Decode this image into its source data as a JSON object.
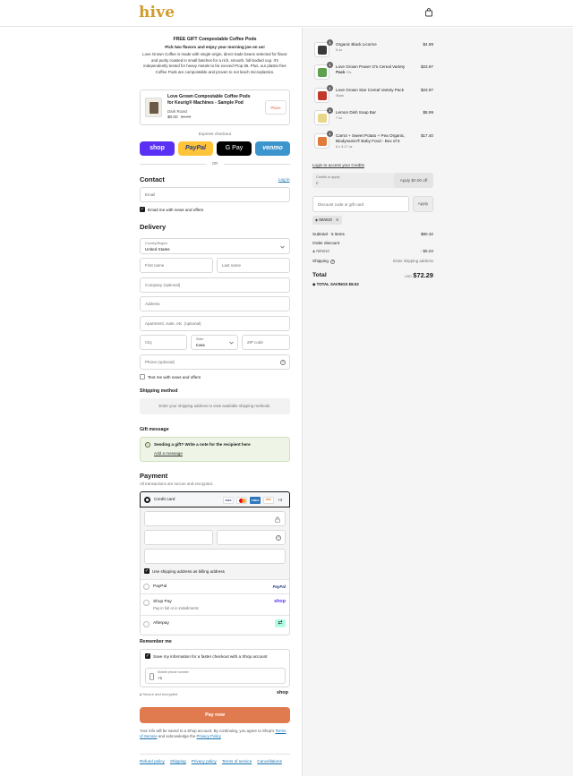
{
  "brand": {
    "logo": "hive"
  },
  "promo": {
    "title": "FREE GIFT Compostable Coffee Pods",
    "subtitle": "Pick two flavors and enjoy your morning joe on us!",
    "body": "Love Grown Coffee is made with single-origin, direct trade beans selected for flavor and purity roasted in small batches for a rich, smooth, full-bodied cup. It's independently tested for heavy metals to far exceed Prop 65. Plus, our plastic-free Coffee Pods are compostable and proven to not leach microplastics.",
    "product_name": "Love Grown Compostable Coffee Pods for Keurig® Machines - Sample Pod",
    "product_variant": "Dark Roast",
    "price": "$0.00",
    "old_price": "$1.50",
    "action": "Place"
  },
  "express": {
    "label": "Express checkout",
    "or": "OR",
    "shop": "shop",
    "paypal": "PayPal",
    "gpay": "G Pay",
    "venmo": "venmo"
  },
  "contact": {
    "heading": "Contact",
    "login": "Log in",
    "email_placeholder": "Email",
    "news_label": "Email me with news and offers"
  },
  "delivery": {
    "heading": "Delivery",
    "country_label": "Country/Region",
    "country_value": "United States",
    "first_name": "First name",
    "last_name": "Last name",
    "company": "Company (optional)",
    "address": "Address",
    "apartment": "Apartment, suite, etc. (optional)",
    "city": "City",
    "state_label": "State",
    "state_value": "Iowa",
    "zip": "ZIP code",
    "phone": "Phone (optional)",
    "text_label": "Text me with news and offers"
  },
  "shipping": {
    "heading": "Shipping method",
    "placeholder": "Enter your shipping address to view available shipping methods."
  },
  "gift": {
    "heading": "Gift message",
    "title": "Sending a gift? Write a note for the recipient here",
    "link": "Add a message"
  },
  "payment": {
    "heading": "Payment",
    "note": "All transactions are secure and encrypted.",
    "credit_card": "Credit card",
    "cards": [
      "VISA",
      "MC",
      "AMEX",
      "DISC"
    ],
    "more": "+4",
    "billing_label": "Use shipping address as billing address",
    "paypal": "PayPal",
    "paypal_logo": "PayPal",
    "shop_pay": "Shop Pay",
    "shop_pay_sub": "Pay in full or in installments",
    "shop_logo": "shop",
    "afterpay": "Afterpay"
  },
  "remember": {
    "heading": "Remember me",
    "save_label": "Save my information for a faster checkout with a Shop account",
    "mobile_label": "Mobile phone number",
    "mobile_value": "+1",
    "secure": "Secure and encrypted",
    "shop_logo": "shop"
  },
  "pay_button": "Pay now",
  "legal": {
    "text": "Your info will be saved to a Shop account. By continuing, you agree to Shop's",
    "terms": "Terms of Service",
    "and": "and acknowledge the",
    "privacy": "Privacy Policy"
  },
  "footer": {
    "links": [
      "Refund policy",
      "Shipping",
      "Privacy policy",
      "Terms of service",
      "Cancellations"
    ]
  },
  "cart": {
    "items": [
      {
        "qty": "1",
        "name": "Organic Black Licorice",
        "variant": "5 oz",
        "price": "$4.89",
        "color": "#3a3a3a"
      },
      {
        "qty": "1",
        "name": "Love Grown Power O's Cereal Variety Pack",
        "variant": "Power O's",
        "price": "$23.97",
        "color": "#5fa04e"
      },
      {
        "qty": "1",
        "name": "Love Grown Star Cereal Variety Pack",
        "variant": "Stars",
        "price": "$23.97",
        "color": "#c0392b"
      },
      {
        "qty": "1",
        "name": "Lemon Dish Soap Bar",
        "variant": "7 oz",
        "price": "$8.99",
        "color": "#e8d68a"
      },
      {
        "qty": "1",
        "name": "Carrot + Sweet Potato + Pea Organic, Biodynamic® Baby Food - Box of 6",
        "variant": "6 x 3.17 oz",
        "price": "$17.40",
        "color": "#e07b39"
      }
    ],
    "credits_link": "Login to access your Credits",
    "credits_label": "Credits to apply",
    "credits_value": "0",
    "credits_button": "Apply $0.00 off",
    "discount_placeholder": "Discount code or gift card",
    "apply": "Apply",
    "code": "NEW10",
    "subtotal_label": "Subtotal · 5 items",
    "subtotal": "$80.32",
    "order_discount": "Order discount",
    "discount_code": "NEW10",
    "discount_value": "- $8.03",
    "shipping_label": "Shipping",
    "shipping_value": "Enter shipping address",
    "total_label": "Total",
    "currency": "USD",
    "total": "$72.29",
    "savings_label": "TOTAL SAVINGS",
    "savings": "$8.03"
  }
}
